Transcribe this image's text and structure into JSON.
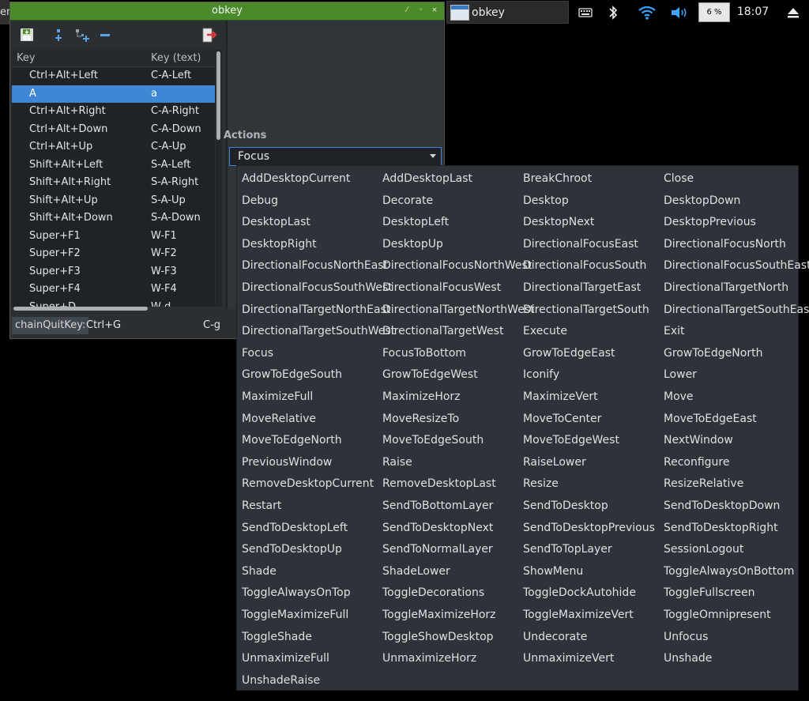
{
  "panel": {
    "left_stub_text": "eni",
    "taskbar_label": "obkey",
    "tray": {
      "keyboard_icon": "keyboard-icon",
      "bluetooth_icon": "bluetooth-icon",
      "wifi_icon": "wifi-icon",
      "volume_icon": "volume-icon",
      "cpu_label": "6 %",
      "clock": "18:07",
      "eject_icon": "eject-icon"
    }
  },
  "window": {
    "title": "obkey",
    "title_buttons": [
      "⁄",
      "◦",
      "×"
    ],
    "toolbar_icons": [
      "save-icon",
      "add-key-icon",
      "add-child-key-icon",
      "remove-icon",
      "quit-icon"
    ],
    "table": {
      "headers": [
        "Key",
        "Key (text)"
      ],
      "rows": [
        {
          "key": "Ctrl+Alt+Left",
          "text": "C-A-Left",
          "selected": false
        },
        {
          "key": "A",
          "text": "a",
          "selected": true
        },
        {
          "key": "Ctrl+Alt+Right",
          "text": "C-A-Right",
          "selected": false
        },
        {
          "key": "Ctrl+Alt+Down",
          "text": "C-A-Down",
          "selected": false
        },
        {
          "key": "Ctrl+Alt+Up",
          "text": "C-A-Up",
          "selected": false
        },
        {
          "key": "Shift+Alt+Left",
          "text": "S-A-Left",
          "selected": false
        },
        {
          "key": "Shift+Alt+Right",
          "text": "S-A-Right",
          "selected": false
        },
        {
          "key": "Shift+Alt+Up",
          "text": "S-A-Up",
          "selected": false
        },
        {
          "key": "Shift+Alt+Down",
          "text": "S-A-Down",
          "selected": false
        },
        {
          "key": "Super+F1",
          "text": "W-F1",
          "selected": false
        },
        {
          "key": "Super+F2",
          "text": "W-F2",
          "selected": false
        },
        {
          "key": "Super+F3",
          "text": "W-F3",
          "selected": false
        },
        {
          "key": "Super+F4",
          "text": "W-F4",
          "selected": false
        },
        {
          "key": "Super+D",
          "text": "W-d",
          "selected": false
        }
      ]
    },
    "chain": {
      "label": "chainQuitKey:",
      "value": "Ctrl+G",
      "text": "C-g"
    },
    "actions_label": "Actions",
    "action_selected": "Focus"
  },
  "dropdown_options": [
    "AddDesktopCurrent",
    "AddDesktopLast",
    "BreakChroot",
    "Close",
    "Debug",
    "Decorate",
    "Desktop",
    "DesktopDown",
    "DesktopLast",
    "DesktopLeft",
    "DesktopNext",
    "DesktopPrevious",
    "DesktopRight",
    "DesktopUp",
    "DirectionalFocusEast",
    "DirectionalFocusNorth",
    "DirectionalFocusNorthEast",
    "DirectionalFocusNorthWest",
    "DirectionalFocusSouth",
    "DirectionalFocusSouthEast",
    "DirectionalFocusSouthWest",
    "DirectionalFocusWest",
    "DirectionalTargetEast",
    "DirectionalTargetNorth",
    "DirectionalTargetNorthEast",
    "DirectionalTargetNorthWest",
    "DirectionalTargetSouth",
    "DirectionalTargetSouthEast",
    "DirectionalTargetSouthWest",
    "DirectionalTargetWest",
    "Execute",
    "Exit",
    "Focus",
    "FocusToBottom",
    "GrowToEdgeEast",
    "GrowToEdgeNorth",
    "GrowToEdgeSouth",
    "GrowToEdgeWest",
    "Iconify",
    "Lower",
    "MaximizeFull",
    "MaximizeHorz",
    "MaximizeVert",
    "Move",
    "MoveRelative",
    "MoveResizeTo",
    "MoveToCenter",
    "MoveToEdgeEast",
    "MoveToEdgeNorth",
    "MoveToEdgeSouth",
    "MoveToEdgeWest",
    "NextWindow",
    "PreviousWindow",
    "Raise",
    "RaiseLower",
    "Reconfigure",
    "RemoveDesktopCurrent",
    "RemoveDesktopLast",
    "Resize",
    "ResizeRelative",
    "Restart",
    "SendToBottomLayer",
    "SendToDesktop",
    "SendToDesktopDown",
    "SendToDesktopLeft",
    "SendToDesktopNext",
    "SendToDesktopPrevious",
    "SendToDesktopRight",
    "SendToDesktopUp",
    "SendToNormalLayer",
    "SendToTopLayer",
    "SessionLogout",
    "Shade",
    "ShadeLower",
    "ShowMenu",
    "ToggleAlwaysOnBottom",
    "ToggleAlwaysOnTop",
    "ToggleDecorations",
    "ToggleDockAutohide",
    "ToggleFullscreen",
    "ToggleMaximizeFull",
    "ToggleMaximizeHorz",
    "ToggleMaximizeVert",
    "ToggleOmnipresent",
    "ToggleShade",
    "ToggleShowDesktop",
    "Undecorate",
    "Unfocus",
    "UnmaximizeFull",
    "UnmaximizeHorz",
    "UnmaximizeVert",
    "Unshade",
    "UnshadeRaise"
  ]
}
